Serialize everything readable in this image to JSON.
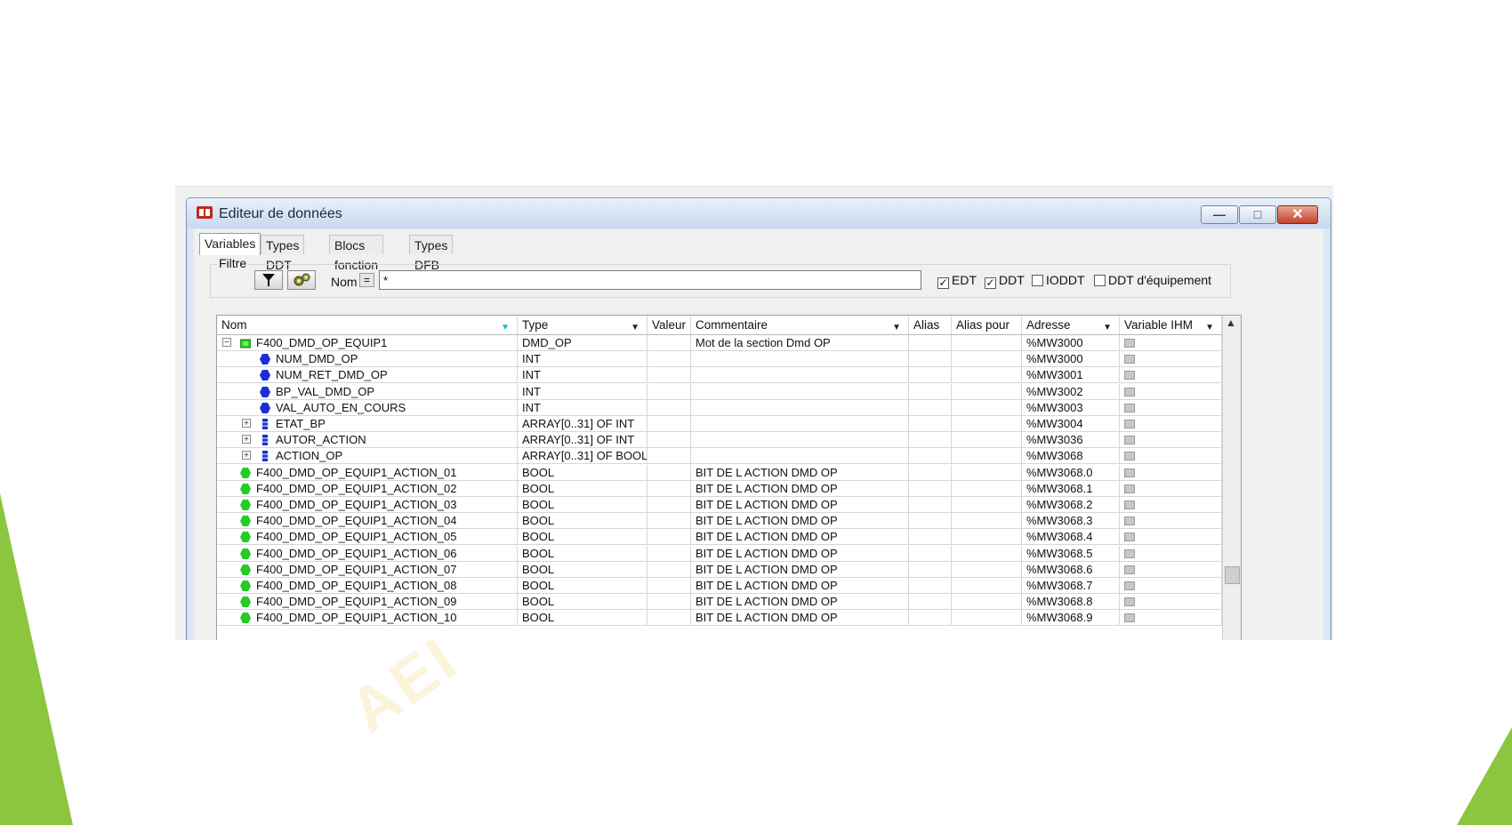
{
  "window": {
    "title": "Editeur de données",
    "buttons": {
      "minimize": "—",
      "maximize": "□",
      "close": "✕"
    }
  },
  "tabs": [
    {
      "label": "Variables",
      "active": true
    },
    {
      "label": "Types DDT",
      "active": false
    },
    {
      "label": "Blocs fonction",
      "active": false
    },
    {
      "label": "Types DFB",
      "active": false
    }
  ],
  "filter": {
    "label": "Filtre",
    "name_label": "Nom",
    "eq_label": "=",
    "value": "*",
    "checks": [
      {
        "label": "EDT",
        "checked": true
      },
      {
        "label": "DDT",
        "checked": true
      },
      {
        "label": "IODDT",
        "checked": false
      },
      {
        "label": "DDT d'équipement",
        "checked": false
      }
    ]
  },
  "columns": [
    "Nom",
    "Type",
    "Valeur",
    "Commentaire",
    "Alias",
    "Alias pour",
    "Adresse",
    "Variable IHM"
  ],
  "rows": [
    {
      "name": "F400_DMD_OP_EQUIP1",
      "type": "DMD_OP",
      "value": "",
      "comment": "Mot de la section Dmd OP",
      "alias": "",
      "alias_for": "",
      "address": "%MW3000",
      "kind": "ddt",
      "level": 0,
      "expander": "−"
    },
    {
      "name": "NUM_DMD_OP",
      "type": "INT",
      "value": "",
      "comment": "",
      "alias": "",
      "alias_for": "",
      "address": "%MW3000",
      "kind": "elem",
      "level": 1,
      "expander": ""
    },
    {
      "name": "NUM_RET_DMD_OP",
      "type": "INT",
      "value": "",
      "comment": "",
      "alias": "",
      "alias_for": "",
      "address": "%MW3001",
      "kind": "elem",
      "level": 1,
      "expander": ""
    },
    {
      "name": "BP_VAL_DMD_OP",
      "type": "INT",
      "value": "",
      "comment": "",
      "alias": "",
      "alias_for": "",
      "address": "%MW3002",
      "kind": "elem",
      "level": 1,
      "expander": ""
    },
    {
      "name": "VAL_AUTO_EN_COURS",
      "type": "INT",
      "value": "",
      "comment": "",
      "alias": "",
      "alias_for": "",
      "address": "%MW3003",
      "kind": "elem",
      "level": 1,
      "expander": ""
    },
    {
      "name": "ETAT_BP",
      "type": "ARRAY[0..31] OF INT",
      "value": "",
      "comment": "",
      "alias": "",
      "alias_for": "",
      "address": "%MW3004",
      "kind": "array",
      "level": 1,
      "expander": "+"
    },
    {
      "name": "AUTOR_ACTION",
      "type": "ARRAY[0..31] OF INT",
      "value": "",
      "comment": "",
      "alias": "",
      "alias_for": "",
      "address": "%MW3036",
      "kind": "array",
      "level": 1,
      "expander": "+"
    },
    {
      "name": "ACTION_OP",
      "type": "ARRAY[0..31] OF BOOL",
      "value": "",
      "comment": "",
      "alias": "",
      "alias_for": "",
      "address": "%MW3068",
      "kind": "array",
      "level": 1,
      "expander": "+"
    },
    {
      "name": "F400_DMD_OP_EQUIP1_ACTION_01",
      "type": "BOOL",
      "value": "",
      "comment": "BIT DE L ACTION DMD OP",
      "alias": "",
      "alias_for": "",
      "address": "%MW3068.0",
      "kind": "edt",
      "level": 0,
      "expander": ""
    },
    {
      "name": "F400_DMD_OP_EQUIP1_ACTION_02",
      "type": "BOOL",
      "value": "",
      "comment": "BIT DE L ACTION DMD OP",
      "alias": "",
      "alias_for": "",
      "address": "%MW3068.1",
      "kind": "edt",
      "level": 0,
      "expander": ""
    },
    {
      "name": "F400_DMD_OP_EQUIP1_ACTION_03",
      "type": "BOOL",
      "value": "",
      "comment": "BIT DE L ACTION DMD OP",
      "alias": "",
      "alias_for": "",
      "address": "%MW3068.2",
      "kind": "edt",
      "level": 0,
      "expander": ""
    },
    {
      "name": "F400_DMD_OP_EQUIP1_ACTION_04",
      "type": "BOOL",
      "value": "",
      "comment": "BIT DE L ACTION DMD OP",
      "alias": "",
      "alias_for": "",
      "address": "%MW3068.3",
      "kind": "edt",
      "level": 0,
      "expander": ""
    },
    {
      "name": "F400_DMD_OP_EQUIP1_ACTION_05",
      "type": "BOOL",
      "value": "",
      "comment": "BIT DE L ACTION DMD OP",
      "alias": "",
      "alias_for": "",
      "address": "%MW3068.4",
      "kind": "edt",
      "level": 0,
      "expander": ""
    },
    {
      "name": "F400_DMD_OP_EQUIP1_ACTION_06",
      "type": "BOOL",
      "value": "",
      "comment": "BIT DE L ACTION DMD OP",
      "alias": "",
      "alias_for": "",
      "address": "%MW3068.5",
      "kind": "edt",
      "level": 0,
      "expander": ""
    },
    {
      "name": "F400_DMD_OP_EQUIP1_ACTION_07",
      "type": "BOOL",
      "value": "",
      "comment": "BIT DE L ACTION DMD OP",
      "alias": "",
      "alias_for": "",
      "address": "%MW3068.6",
      "kind": "edt",
      "level": 0,
      "expander": ""
    },
    {
      "name": "F400_DMD_OP_EQUIP1_ACTION_08",
      "type": "BOOL",
      "value": "",
      "comment": "BIT DE L ACTION DMD OP",
      "alias": "",
      "alias_for": "",
      "address": "%MW3068.7",
      "kind": "edt",
      "level": 0,
      "expander": ""
    },
    {
      "name": "F400_DMD_OP_EQUIP1_ACTION_09",
      "type": "BOOL",
      "value": "",
      "comment": "BIT DE L ACTION DMD OP",
      "alias": "",
      "alias_for": "",
      "address": "%MW3068.8",
      "kind": "edt",
      "level": 0,
      "expander": ""
    },
    {
      "name": "F400_DMD_OP_EQUIP1_ACTION_10",
      "type": "BOOL",
      "value": "",
      "comment": "BIT DE L ACTION DMD OP",
      "alias": "",
      "alias_for": "",
      "address": "%MW3068.9",
      "kind": "edt",
      "level": 0,
      "expander": ""
    }
  ],
  "watermark": "AEI",
  "colors": {
    "accent_green": "#8cc63f",
    "elem_blue": "#1a2fd8",
    "edt_green": "#22cc22",
    "close_red": "#c4432c"
  }
}
